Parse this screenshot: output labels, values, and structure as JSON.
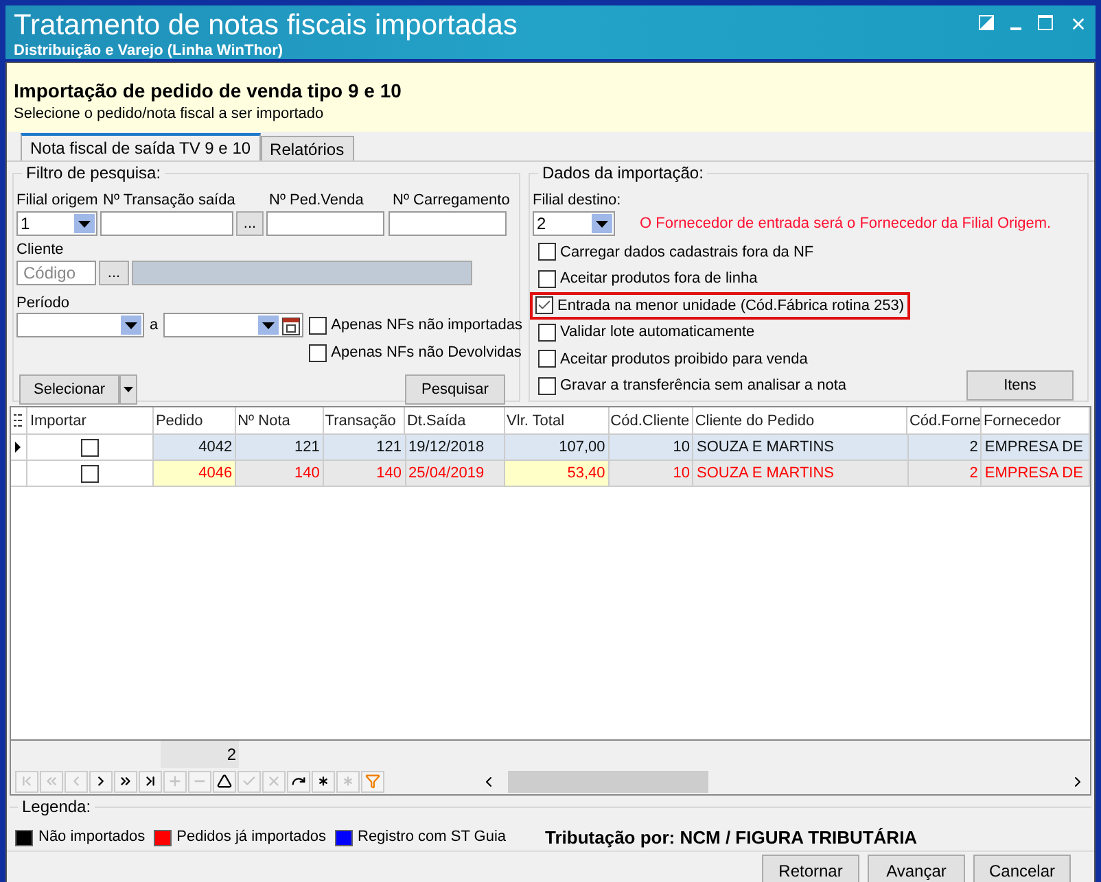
{
  "window": {
    "title": "Tratamento de notas fiscais importadas",
    "subtitle": "Distribuição e Varejo (Linha WinThor)"
  },
  "header": {
    "title": "Importação de pedido de venda tipo 9 e 10",
    "hint": "Selecione o pedido/nota fiscal a ser importado"
  },
  "tabs": [
    {
      "label": "Nota fiscal de saída TV 9 e 10",
      "selected": true
    },
    {
      "label": "Relatórios",
      "selected": false
    }
  ],
  "filter": {
    "title": "Filtro de pesquisa:",
    "filial_label": "Filial origem",
    "filial_value": "1",
    "transacao_label": "Nº Transação saída",
    "ped_venda_label": "Nº Ped.Venda",
    "carregamento_label": "Nº Carregamento",
    "cliente_label": "Cliente",
    "cliente_placeholder": "Código",
    "ellipsis": "...",
    "periodo_label": "Período",
    "periodo_sep": "a",
    "options": [
      {
        "label": "Apenas NFs não importadas",
        "checked": false
      },
      {
        "label": "Apenas NFs não Devolvidas",
        "checked": false
      }
    ],
    "select_button": "Selecionar",
    "search_button": "Pesquisar"
  },
  "import": {
    "title": "Dados da importação:",
    "filial_label": "Filial destino:",
    "filial_value": "2",
    "notice": "O Fornecedor de entrada será o Fornecedor da Filial Origem.",
    "options": [
      {
        "label": "Carregar dados cadastrais fora da NF",
        "checked": false,
        "highlighted": false
      },
      {
        "label": "Aceitar produtos fora de linha",
        "checked": false,
        "highlighted": false
      },
      {
        "label": "Entrada na menor unidade (Cód.Fábrica rotina 253)",
        "checked": true,
        "highlighted": true
      },
      {
        "label": "Validar lote automaticamente",
        "checked": false,
        "highlighted": false
      },
      {
        "label": "Aceitar produtos proibido para venda",
        "checked": false,
        "highlighted": false
      },
      {
        "label": "Gravar a transferência sem analisar a nota",
        "checked": false,
        "highlighted": false
      }
    ],
    "items_button": "Itens"
  },
  "table": {
    "check_column": "Importar",
    "columns": [
      "Pedido",
      "Nº Nota",
      "Transação",
      "Dt.Saída",
      "Vlr. Total",
      "Cód.Cliente",
      "Cliente do Pedido",
      "Cód.Forne",
      "Fornecedor"
    ],
    "rows": [
      {
        "current": true,
        "imported": false,
        "checked": false,
        "cells": [
          {
            "text": "4042",
            "highlighted": false
          },
          {
            "text": "121",
            "highlighted": false
          },
          {
            "text": "121",
            "highlighted": false
          },
          {
            "text": "19/12/2018",
            "highlighted": false
          },
          {
            "text": "107,00",
            "highlighted": false
          },
          {
            "text": "10",
            "highlighted": false
          },
          {
            "text": "SOUZA E MARTINS",
            "highlighted": false
          },
          {
            "text": "2",
            "highlighted": false
          },
          {
            "text": "EMPRESA DE",
            "highlighted": false
          }
        ]
      },
      {
        "current": false,
        "imported": true,
        "checked": false,
        "cells": [
          {
            "text": "4046",
            "highlighted": true
          },
          {
            "text": "140",
            "highlighted": false
          },
          {
            "text": "140",
            "highlighted": false
          },
          {
            "text": "25/04/2019",
            "highlighted": false
          },
          {
            "text": "53,40",
            "highlighted": true
          },
          {
            "text": "10",
            "highlighted": false
          },
          {
            "text": "SOUZA E MARTINS",
            "highlighted": false
          },
          {
            "text": "2",
            "highlighted": false
          },
          {
            "text": "EMPRESA DE",
            "highlighted": false
          }
        ]
      }
    ],
    "count": "2"
  },
  "navigator": [
    {
      "kind": "first",
      "disabled": true
    },
    {
      "kind": "prior-page",
      "disabled": true
    },
    {
      "kind": "prior",
      "disabled": true
    },
    {
      "kind": "next",
      "disabled": false
    },
    {
      "kind": "next-page",
      "disabled": false
    },
    {
      "kind": "last",
      "disabled": false
    },
    {
      "kind": "insert",
      "disabled": true
    },
    {
      "kind": "delete",
      "disabled": true
    },
    {
      "kind": "up",
      "disabled": false
    },
    {
      "kind": "post",
      "disabled": true
    },
    {
      "kind": "cancel",
      "disabled": true
    },
    {
      "kind": "refresh",
      "disabled": false
    },
    {
      "kind": "bookmark",
      "disabled": false
    },
    {
      "kind": "goto",
      "disabled": true
    },
    {
      "kind": "filter",
      "disabled": false
    }
  ],
  "legend": {
    "title": "Legenda:",
    "items": [
      {
        "label": "Não importados",
        "color": "#000000"
      },
      {
        "label": "Pedidos já importados",
        "color": "#ff0000"
      },
      {
        "label": "Registro com ST Guia",
        "color": "#0000ff"
      }
    ],
    "taxation": "Tributação por: NCM / FIGURA TRIBUTÁRIA"
  },
  "buttons": [
    "Retornar",
    "Avançar",
    "Cancelar"
  ]
}
